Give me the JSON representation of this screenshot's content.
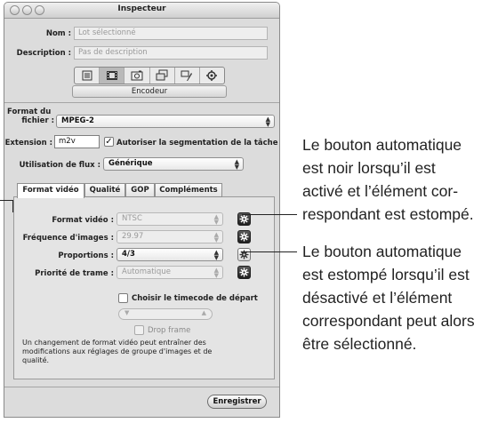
{
  "window": {
    "title": "Inspecteur",
    "nom_label": "Nom :",
    "nom_value": "Lot sélectionné",
    "description_label": "Description :",
    "description_value": "Pas de description",
    "icon_toolbar": [
      "list-icon",
      "film-icon",
      "photo-icon",
      "stack-icon",
      "tools-icon",
      "gear-icon"
    ],
    "selected_icon_index": 1,
    "encoder_label": "Encodeur"
  },
  "encoder": {
    "format_label_line1": "Format du",
    "format_label_line2": "fichier :",
    "format_value": "MPEG-2",
    "extension_label": "Extension :",
    "extension_value": "m2v",
    "segmentation_label": "Autoriser la segmentation de la tâche",
    "segmentation_checked": true,
    "stream_label": "Utilisation de flux :",
    "stream_value": "Générique"
  },
  "tabs": [
    {
      "label": "Format vidéo",
      "selected": true
    },
    {
      "label": "Qualité",
      "selected": false
    },
    {
      "label": "GOP",
      "selected": false
    },
    {
      "label": "Compléments",
      "selected": false
    }
  ],
  "video": {
    "format_label": "Format vidéo :",
    "format_value": "NTSC",
    "framerate_label": "Fréquence d'images :",
    "framerate_value": "29.97",
    "aspect_label": "Proportions :",
    "aspect_value": "4/3",
    "fieldorder_label": "Priorité de trame :",
    "fieldorder_value": "Automatique",
    "timecode_label": "Choisir le timecode de départ",
    "dropframe_label": "Drop frame",
    "note_line1": "Un changement de format vidéo peut entraîner des",
    "note_line2": "modifications aux réglages de groupe d'images et de",
    "note_line3": "qualité."
  },
  "save_label": "Enregistrer",
  "callouts": {
    "first": [
      "Le bouton automatique",
      "est noir lorsqu’il est",
      "activé et l’élément cor-",
      "respondant est estompé."
    ],
    "second": [
      "Le bouton automatique",
      "est estompé lorsqu’il est",
      "désactivé et l’élément",
      "correspondant peut alors",
      "être sélectionné."
    ]
  },
  "colors": {
    "window_bg": "#dcdcdc",
    "panel_bg": "#e4e4e4",
    "auto_button_active": "#1e1e1e",
    "text": "#222222"
  }
}
